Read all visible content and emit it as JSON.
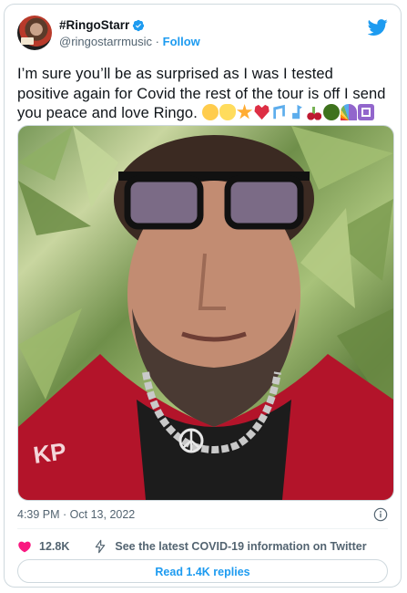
{
  "author": {
    "display_name": "#RingoStarr",
    "handle": "@ringostarrmusic",
    "separator": " · ",
    "follow_label": "Follow"
  },
  "tweet": {
    "text": "I’m sure you’ll be as surprised as I was I tested positive again for Covid the rest of the tour is off I send you peace and love Ringo. ",
    "emojis": [
      "sunglasses-face",
      "victory-hand",
      "star",
      "red-heart",
      "music-notes",
      "music-note",
      "cherries",
      "broccoli",
      "rainbow",
      "peace-symbol"
    ]
  },
  "meta": {
    "time": "4:39 PM",
    "separator": " · ",
    "date": "Oct 13, 2022"
  },
  "actions": {
    "like_count": "12.8K",
    "covid_link": "See the latest COVID-19 information on Twitter"
  },
  "replies_button": "Read 1.4K replies",
  "colors": {
    "accent": "#1d9bf0",
    "like": "#f91880",
    "text": "#0f1419",
    "muted": "#536471",
    "border": "#cfd9de"
  }
}
